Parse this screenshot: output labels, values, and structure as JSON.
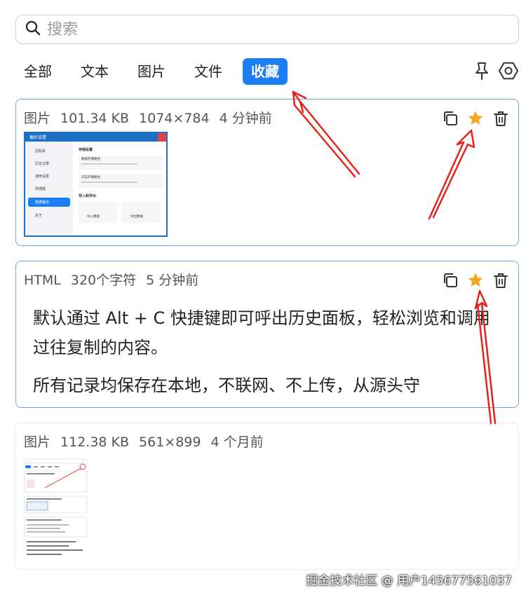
{
  "search": {
    "placeholder": "搜索"
  },
  "tabs": [
    {
      "label": "全部"
    },
    {
      "label": "文本"
    },
    {
      "label": "图片"
    },
    {
      "label": "文件"
    },
    {
      "label": "收藏"
    }
  ],
  "active_tab": "收藏",
  "colors": {
    "accent": "#1c7ef5",
    "star": "#f5a623",
    "annotation": "#e5231b"
  },
  "icons": {
    "search": "search-icon",
    "pin": "pin-icon",
    "settings": "settings-hexagon-icon",
    "copy": "copy-icon",
    "star": "star-icon",
    "delete": "trash-icon"
  },
  "items": [
    {
      "type": "图片",
      "size": "101.34 KB",
      "dims": "1074×784",
      "time": "4 分钟前",
      "thumb": {
        "title": "偏好设置",
        "menu": [
          "剪贴板",
          "历史记录",
          "通用设置",
          "快捷键",
          "数据备份",
          "关于"
        ],
        "section": "存储设置",
        "field1_label": "数据存储路径",
        "field2_label": "日志存储路径",
        "section2": "导入和导出",
        "btn_import": "导入数据",
        "btn_export": "导出数据"
      }
    },
    {
      "type": "HTML",
      "size": "320个字符",
      "time": "5 分钟前",
      "paragraphs": [
        "默认通过 Alt + C 快捷键即可呼出历史面板，轻松浏览和调用过往复制的内容。",
        "所有记录均保存在本地，不联网、不上传，从源头守"
      ]
    },
    {
      "type": "图片",
      "size": "112.38 KB",
      "dims": "561×899",
      "time": "4 个月前"
    }
  ],
  "watermark": "掘金技术社区 @ 用户145677561037"
}
